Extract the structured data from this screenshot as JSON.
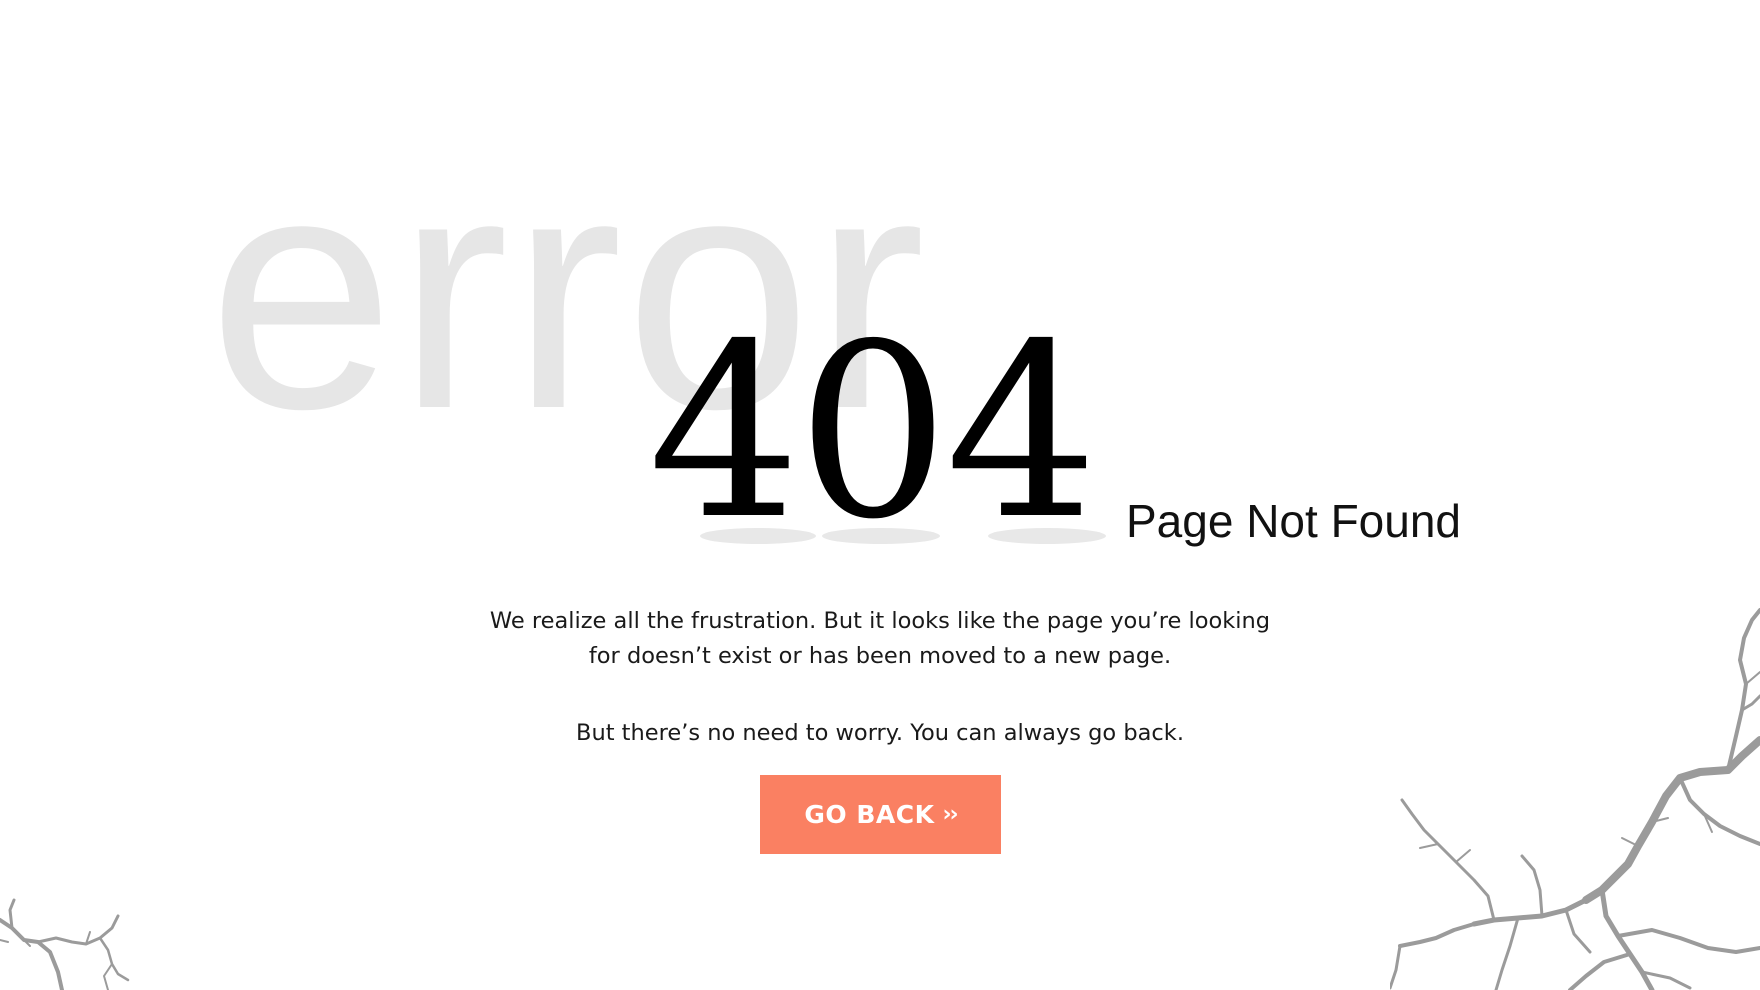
{
  "background_word": "error",
  "error_code": "404",
  "subtitle": "Page Not Found",
  "message": {
    "line1": "We realize all the frustration. But it looks like the page you’re looking",
    "line2": "for doesn’t exist or has been moved to a new page."
  },
  "reassurance": "But there’s no need to worry. You can always go back.",
  "button": {
    "label": "GO BACK",
    "chevron": "››"
  },
  "colors": {
    "accent": "#fa8062",
    "background_word": "#e6e6e6",
    "crack": "#9b9b9b"
  },
  "decorations": {
    "bottom_left": "crack-graphic",
    "bottom_right": "crack-graphic"
  }
}
